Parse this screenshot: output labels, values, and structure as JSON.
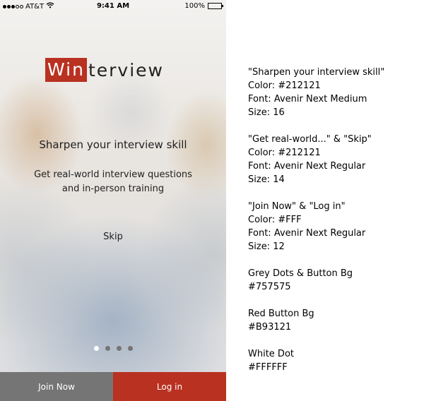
{
  "status_bar": {
    "carrier": "AT&T",
    "time": "9:41 AM",
    "battery": "100%"
  },
  "logo": {
    "highlight": "Win",
    "rest": "terview"
  },
  "headline": "Sharpen your interview skill",
  "subtext": {
    "line1": "Get real-world interview questions",
    "line2": "and in-person training"
  },
  "skip_label": "Skip",
  "pager": {
    "count": 4,
    "active_index": 0
  },
  "buttons": {
    "join": "Join Now",
    "login": "Log in"
  },
  "colors": {
    "text": "#212121",
    "grey": "#757575",
    "red": "#B93121",
    "white": "#FFFFFF"
  },
  "notes": [
    {
      "lines": [
        "\"Sharpen your interview skill\"",
        "Color: #212121",
        "Font: Avenir Next Medium",
        "Size: 16"
      ]
    },
    {
      "lines": [
        "\"Get real-world...\" & \"Skip\"",
        "Color: #212121",
        "Font: Avenir Next Regular",
        "Size: 14"
      ]
    },
    {
      "lines": [
        "\"Join Now\" & \"Log in\"",
        "Color: #FFF",
        "Font: Avenir Next Regular",
        "Size: 12"
      ]
    },
    {
      "lines": [
        "Grey Dots & Button Bg",
        "#757575"
      ]
    },
    {
      "lines": [
        "Red Button Bg",
        "#B93121"
      ]
    },
    {
      "lines": [
        "White Dot",
        "#FFFFFF"
      ]
    }
  ]
}
